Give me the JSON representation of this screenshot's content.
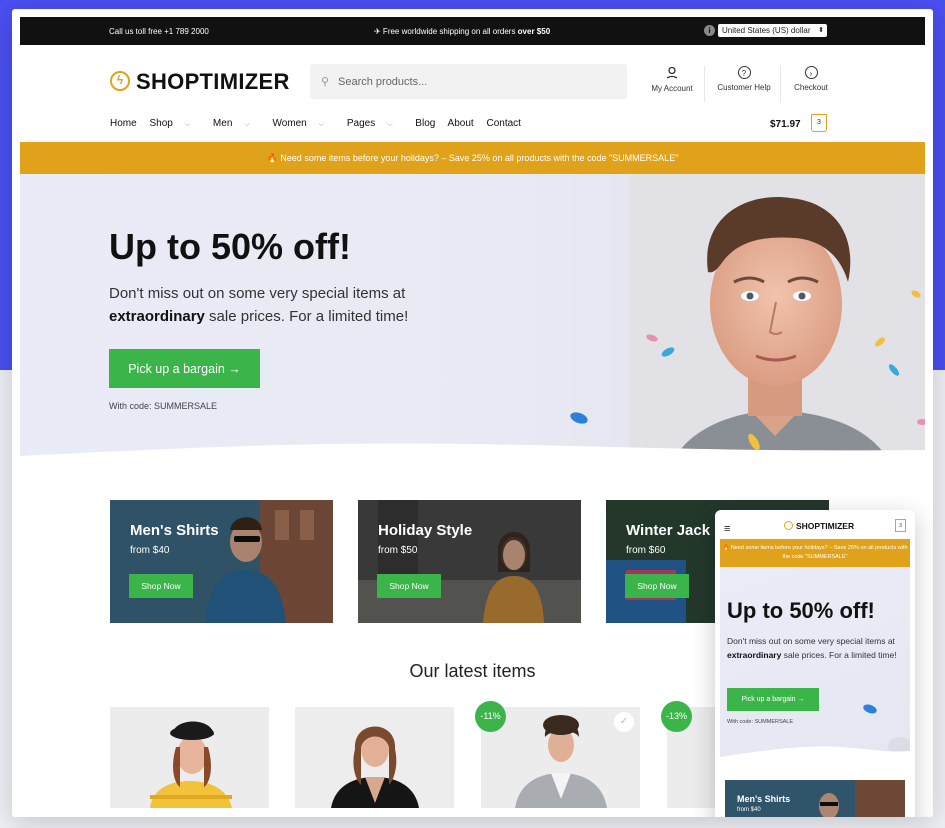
{
  "topbar": {
    "phone": "Call us toll free +1 789 2000",
    "shipping_prefix": "✈ Free worldwide shipping on all orders ",
    "shipping_amount": "over $50",
    "currency": "United States (US) dollar"
  },
  "header": {
    "logo": "SHOPTIMIZER",
    "search_placeholder": "Search products...",
    "icons": [
      {
        "label": "My Account",
        "icon": "user-icon"
      },
      {
        "label": "Customer Help",
        "icon": "help-icon"
      },
      {
        "label": "Checkout",
        "icon": "arrow-circle-icon"
      }
    ]
  },
  "nav": {
    "items": [
      "Home",
      "Shop",
      "Men",
      "Women",
      "Pages",
      "Blog",
      "About",
      "Contact"
    ],
    "cart_total": "$71.97",
    "cart_count": "3"
  },
  "promo": "🔥 Need some items before your holidays? – Save 25% on all products with the code \"SUMMERSALE\"",
  "hero": {
    "title": "Up to 50% off!",
    "text_line1": "Don't miss out on some very special items at ",
    "text_bold": "extraordinary",
    "text_line2": " sale prices. For a limited time!",
    "button": "Pick up a bargain →",
    "code": "With code: SUMMERSALE"
  },
  "categories": [
    {
      "title": "Men's Shirts",
      "price": "from $40",
      "button": "Shop Now"
    },
    {
      "title": "Holiday Style",
      "price": "from $50",
      "button": "Shop Now"
    },
    {
      "title": "Winter Jack",
      "price": "from $60",
      "button": "Shop Now"
    }
  ],
  "latest_title": "Our latest items",
  "badges": [
    "-11%",
    "-13%"
  ],
  "mobile": {
    "logo": "SHOPTIMIZER",
    "cart_count": "3",
    "promo": "🔥 Need some items before your holidays? – Save 25% on all products with the code \"SUMMERSALE\"",
    "title": "Up to 50% off!",
    "text_pre": "Don't miss out on some very special items at ",
    "text_bold": "extraordinary",
    "text_post": " sale prices. For a limited time!",
    "button": "Pick up a bargain →",
    "code": "With code: SUMMERSALE",
    "cat_title": "Men's Shirts",
    "cat_price": "from $40"
  },
  "colors": {
    "accent_green": "#3bb54a",
    "promo_orange": "#dfa21a",
    "background_blue": "#4a4ff0"
  }
}
